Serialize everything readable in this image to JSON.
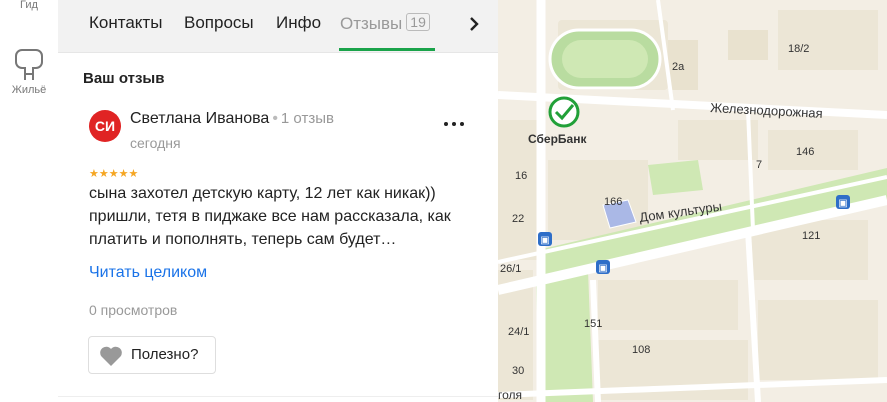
{
  "leftnav": {
    "guide_label": "Гид",
    "housing_label": "Жильё"
  },
  "tabs": {
    "contacts": "Контакты",
    "questions": "Вопросы",
    "info": "Инфо",
    "reviews": "Отзывы",
    "reviews_count": "19"
  },
  "section": {
    "title": "Ваш отзыв"
  },
  "review": {
    "avatar_initials": "СИ",
    "author": "Светлана Иванова",
    "author_reviews": "1 отзыв",
    "date": "сегодня",
    "rating": 5,
    "stars": "★★★★★",
    "text": "сына захотел детскую карту, 12 лет как никак)) пришли, тетя в пиджаке все нам рассказала, как платить и пополнять, теперь сам будет…",
    "read_more": "Читать целиком",
    "views": "0 просмотров",
    "useful_label": "Полезно?"
  },
  "map": {
    "labels": {
      "bank": "СберБанк",
      "street1": "Железнодорожная",
      "culture": "Дом культуры",
      "street2": "голя",
      "b2a": "2а",
      "b18_2": "18/2",
      "b7": "7",
      "b146": "146",
      "b16": "16",
      "b166": "166",
      "b22": "22",
      "b121": "121",
      "b26_1": "26/1",
      "b151": "151",
      "b24_1": "24/1",
      "b108": "108",
      "b30": "30"
    },
    "colors": {
      "background": "#f3eee4",
      "block": "#ece6d6",
      "park": "#cfe8b4",
      "road": "#ffffff",
      "stadium": "#b9dca0",
      "bank_brand": "#21a038",
      "bus": "#2e6ec8"
    }
  },
  "accent": "#1aa34a"
}
